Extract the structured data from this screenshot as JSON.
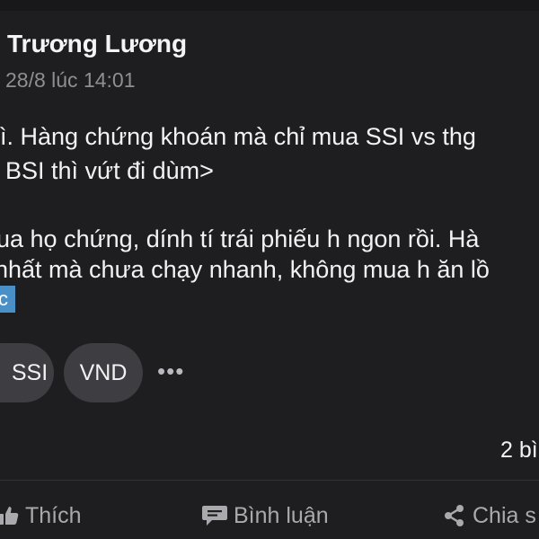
{
  "post": {
    "author": "Trương Lương",
    "timestamp": "28/8 lúc 14:01",
    "body_lines": [
      "ì. Hàng chứng khoán mà chỉ mua SSI vs thg",
      "BSI thì vứt đi dùm>",
      "ua họ chứng, dính tí trái phiếu h ngon rồi. Hà",
      "nhất mà chưa chạy nhanh, không mua h ăn lồ"
    ],
    "highlighted_tag": "c",
    "tags": [
      "SSI",
      "VND"
    ],
    "more_label": "•••",
    "comment_count": "2 bì"
  },
  "actions": {
    "like": "Thích",
    "comment": "Bình luận",
    "share": "Chia s"
  },
  "colors": {
    "background": "#1e1e20",
    "text": "#f2f2f2",
    "muted": "#8e8e93",
    "pill": "#3d3d42",
    "tag_highlight": "#4a90c8",
    "action": "#a9a9ae"
  },
  "icons": {
    "like": "thumbs-up-icon",
    "comment": "comment-bubble-icon",
    "share": "share-icon",
    "more": "more-dots-icon"
  }
}
